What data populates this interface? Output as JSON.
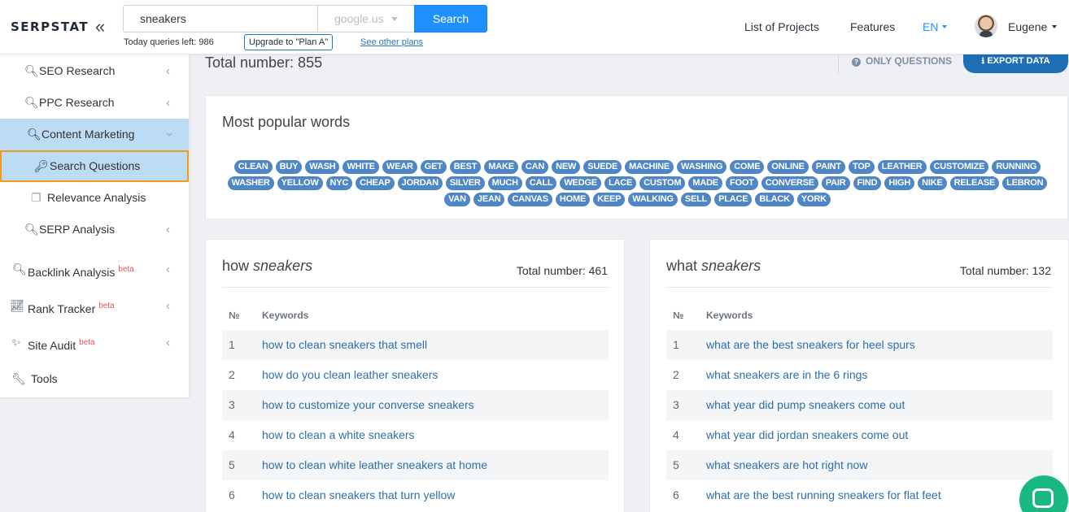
{
  "header": {
    "logo": "SERPSTAT",
    "collapse_icon": "«",
    "search_value": "sneakers",
    "region": "google.us",
    "search_button": "Search",
    "queries_left": "Today queries left: 986",
    "upgrade": "Upgrade to \"Plan A\"",
    "other_plans": "See other plans",
    "nav": [
      "List of Projects",
      "Features"
    ],
    "lang": "EN",
    "user": "Eugene"
  },
  "sidebar": {
    "items": [
      {
        "label": "SEO Research",
        "icon": "search-icon"
      },
      {
        "label": "PPC Research",
        "icon": "search-icon"
      },
      {
        "label": "Content Marketing",
        "icon": "search-icon"
      },
      {
        "label": "Search Questions",
        "icon": "key-icon"
      },
      {
        "label": "Relevance Analysis",
        "icon": "copy-icon"
      },
      {
        "label": "SERP Analysis",
        "icon": "search-icon"
      },
      {
        "label": "Backlink Analysis",
        "icon": "search-icon",
        "badge": "beta"
      },
      {
        "label": "Rank Tracker",
        "icon": "chart-line-icon",
        "badge": "beta"
      },
      {
        "label": "Site Audit",
        "icon": "magic-wand-icon",
        "badge": "beta"
      },
      {
        "label": "Tools",
        "icon": "wrench-icon"
      }
    ]
  },
  "main": {
    "total_number": "Total number: 855",
    "only_questions": "ONLY QUESTIONS",
    "export": "EXPORT DATA",
    "popular_title": "Most popular words",
    "words": [
      "CLEAN",
      "BUY",
      "WASH",
      "WHITE",
      "WEAR",
      "GET",
      "BEST",
      "MAKE",
      "CAN",
      "NEW",
      "SUEDE",
      "MACHINE",
      "WASHING",
      "COME",
      "ONLINE",
      "PAINT",
      "TOP",
      "LEATHER",
      "CUSTOMIZE",
      "RUNNING",
      "WASHER",
      "YELLOW",
      "NYC",
      "CHEAP",
      "JORDAN",
      "SILVER",
      "MUCH",
      "CALL",
      "WEDGE",
      "LACE",
      "CUSTOM",
      "MADE",
      "FOOT",
      "CONVERSE",
      "PAIR",
      "FIND",
      "HIGH",
      "NIKE",
      "RELEASE",
      "LEBRON",
      "VAN",
      "JEAN",
      "CANVAS",
      "HOME",
      "KEEP",
      "WALKING",
      "SELL",
      "PLACE",
      "BLACK",
      "YORK"
    ],
    "panels": [
      {
        "word": "how",
        "term": "sneakers",
        "total": "Total number: 461",
        "col_num": "№",
        "col_kw": "Keywords",
        "rows": [
          {
            "n": "1",
            "kw": "how to clean sneakers that smell"
          },
          {
            "n": "2",
            "kw": "how do you clean leather sneakers"
          },
          {
            "n": "3",
            "kw": "how to customize your converse sneakers"
          },
          {
            "n": "4",
            "kw": "how to clean a white sneakers"
          },
          {
            "n": "5",
            "kw": "how to clean white leather sneakers at home"
          },
          {
            "n": "6",
            "kw": "how to clean sneakers that turn yellow"
          }
        ]
      },
      {
        "word": "what",
        "term": "sneakers",
        "total": "Total number: 132",
        "col_num": "№",
        "col_kw": "Keywords",
        "rows": [
          {
            "n": "1",
            "kw": "what are the best sneakers for heel spurs"
          },
          {
            "n": "2",
            "kw": "what sneakers are in the 6 rings"
          },
          {
            "n": "3",
            "kw": "what year did pump sneakers come out"
          },
          {
            "n": "4",
            "kw": "what year did jordan sneakers come out"
          },
          {
            "n": "5",
            "kw": "what sneakers are hot right now"
          },
          {
            "n": "6",
            "kw": "what are the best running sneakers for flat feet"
          }
        ]
      }
    ]
  },
  "chat_icon": "chat-bubble-icon"
}
